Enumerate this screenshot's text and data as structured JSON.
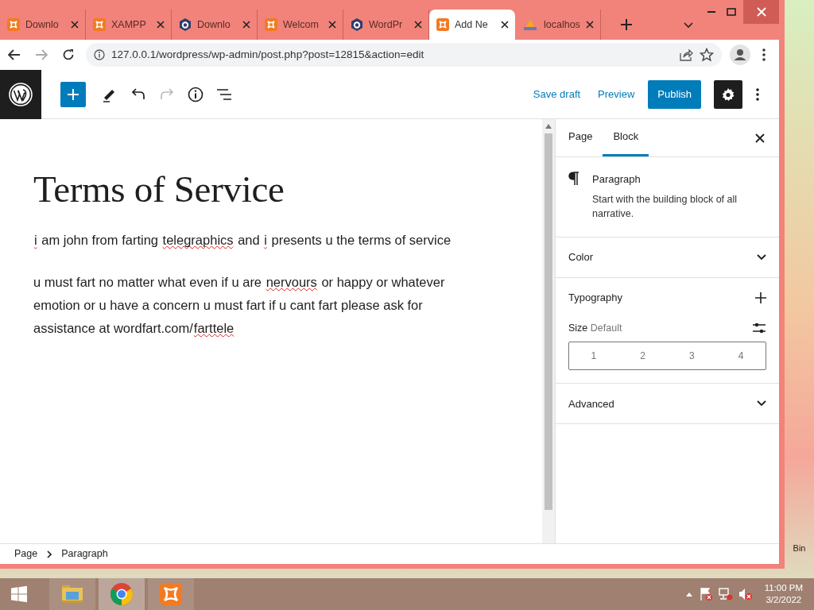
{
  "browser": {
    "tabs": [
      {
        "label": "Downlo",
        "kind": "xampp",
        "selected": false
      },
      {
        "label": "XAMPP",
        "kind": "xampp",
        "selected": false
      },
      {
        "label": "Downlo",
        "kind": "hexagon",
        "selected": false
      },
      {
        "label": "Welcom",
        "kind": "xampp",
        "selected": false
      },
      {
        "label": "WordPr",
        "kind": "hexagon",
        "selected": false
      },
      {
        "label": "Add Ne",
        "kind": "xampp",
        "selected": true
      },
      {
        "label": "localhos",
        "kind": "pma",
        "selected": false
      }
    ],
    "address": "127.0.0.1/wordpress/wp-admin/post.php?post=12815&action=edit"
  },
  "toolbar": {
    "save_draft": "Save draft",
    "preview": "Preview",
    "publish": "Publish",
    "redo_disabled": true
  },
  "editor": {
    "title": "Terms of Service",
    "paragraphs": [
      [
        {
          "text": "i",
          "misspelled": true
        },
        {
          "text": " am john from farting ",
          "misspelled": false
        },
        {
          "text": "telegraphics",
          "misspelled": true
        },
        {
          "text": " and ",
          "misspelled": false
        },
        {
          "text": "i",
          "misspelled": true
        },
        {
          "text": " presents u the terms of service",
          "misspelled": false
        }
      ],
      [
        {
          "text": "u must fart no matter what even if u are ",
          "misspelled": false
        },
        {
          "text": "nervours",
          "misspelled": true
        },
        {
          "text": " or happy or whatever emotion or u have a concern u must fart if u cant fart please ask for assistance at wordfart.com/",
          "misspelled": false
        },
        {
          "text": "farttele",
          "misspelled": true
        }
      ]
    ]
  },
  "sidebar": {
    "tabs": [
      {
        "label": "Page",
        "selected": false
      },
      {
        "label": "Block",
        "selected": true
      }
    ],
    "block": {
      "name": "Paragraph",
      "description": "Start with the building block of all narrative."
    },
    "panels": [
      {
        "kind": "collapsed",
        "label": "Color"
      },
      {
        "kind": "typography",
        "label": "Typography",
        "size_label": "Size",
        "size_value": "Default",
        "sizes": [
          "1",
          "2",
          "3",
          "4"
        ]
      },
      {
        "kind": "collapsed",
        "label": "Advanced"
      }
    ]
  },
  "breadcrumb": [
    "Page",
    "Paragraph"
  ],
  "desktop": {
    "icon_label": "Bin"
  },
  "taskbar": {
    "apps": [
      {
        "kind": "explorer",
        "selected": false
      },
      {
        "kind": "chrome",
        "selected": true
      },
      {
        "kind": "xampp",
        "selected": false
      }
    ],
    "time": "11:00 PM",
    "date": "3/2/2022"
  }
}
